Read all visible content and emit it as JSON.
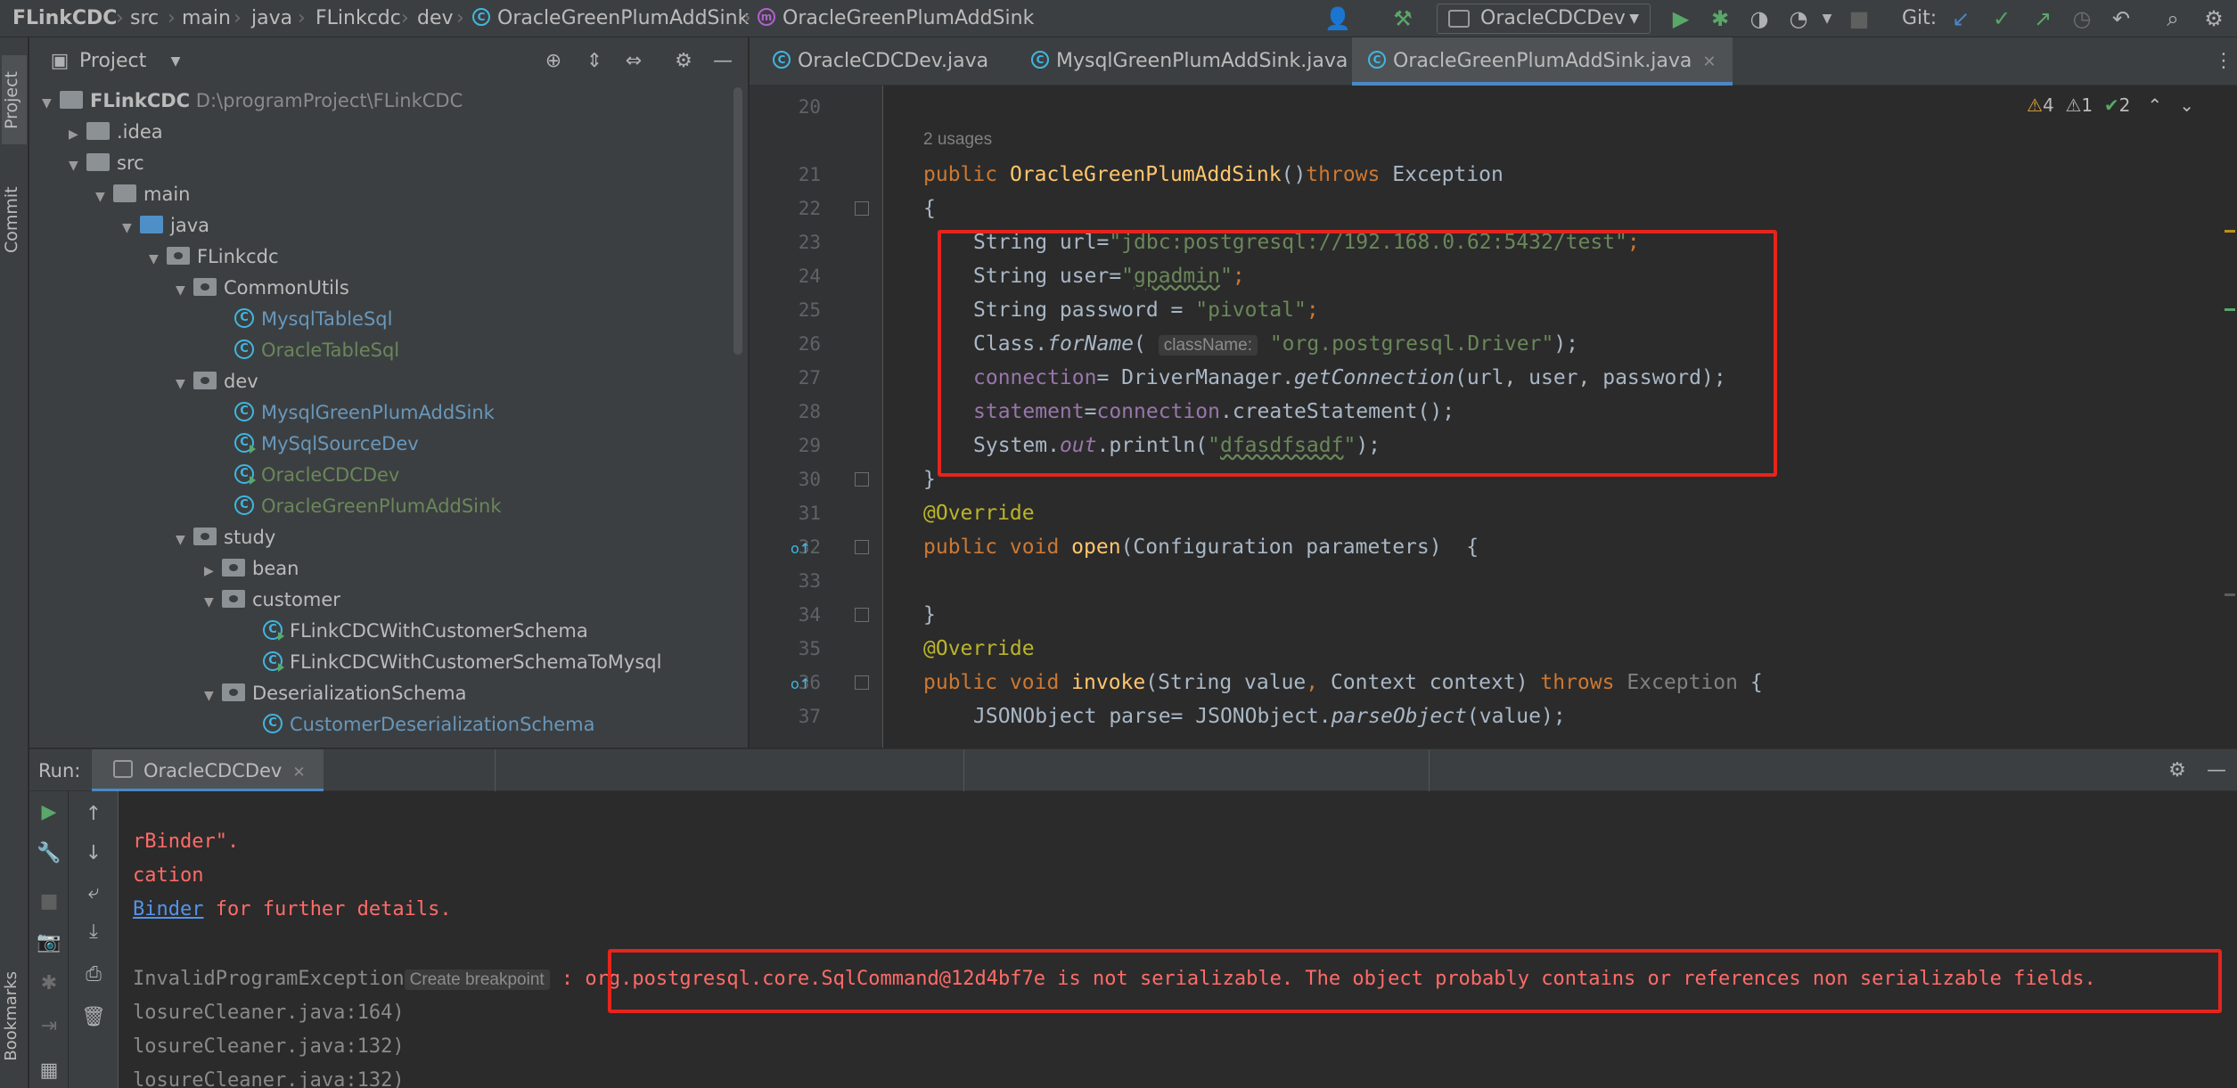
{
  "breadcrumb": {
    "items": [
      "FLinkCDC",
      "src",
      "main",
      "java",
      "FLinkcdc",
      "dev",
      "OracleGreenPlumAddSink",
      "OracleGreenPlumAddSink"
    ]
  },
  "toolbar": {
    "run_config": "OracleCDCDev",
    "git_label": "Git:"
  },
  "left_stripe": {
    "project": "Project",
    "commit": "Commit",
    "bookmarks": "Bookmarks"
  },
  "project_panel": {
    "title": "Project",
    "root_name": "FLinkCDC",
    "root_path": "D:\\programProject\\FLinkCDC",
    "tree": [
      "FLinkCDC",
      ".idea",
      "src",
      "main",
      "java",
      "FLinkcdc",
      "CommonUtils",
      "MysqlTableSql",
      "OracleTableSql",
      "dev",
      "MysqlGreenPlumAddSink",
      "MySqlSourceDev",
      "OracleCDCDev",
      "OracleGreenPlumAddSink",
      "study",
      "bean",
      "customer",
      "FLinkCDCWithCustomerSchema",
      "FLinkCDCWithCustomerSchemaToMysql",
      "DeserializationSchema",
      "CustomerDeserializationSchema"
    ]
  },
  "editor": {
    "tabs": [
      "OracleCDCDev.java",
      "MysqlGreenPlumAddSink.java",
      "OracleGreenPlumAddSink.java"
    ],
    "active_tab": "OracleGreenPlumAddSink.java",
    "inspections": {
      "warnings": "4",
      "weak_warnings": "1",
      "typos": "2"
    },
    "usages": "2 usages",
    "line_numbers": [
      "20",
      "21",
      "22",
      "23",
      "24",
      "25",
      "26",
      "27",
      "28",
      "29",
      "30",
      "31",
      "32",
      "33",
      "34",
      "35",
      "36",
      "37"
    ],
    "code": {
      "l21_kw": "public",
      "l21_name": "OracleGreenPlumAddSink",
      "l21_parens": "()",
      "l21_throws": "throws",
      "l21_exc": " Exception",
      "l22": "{",
      "l23_a": "String url=",
      "l23_str": "\"jdbc:postgresql://192.168.0.62:5432/test\"",
      "l23_end": ";",
      "l24_a": "String user=",
      "l24_q1": "\"",
      "l24_str": "gpadmin",
      "l24_q2": "\"",
      "l24_end": ";",
      "l25_a": "String password = ",
      "l25_str": "\"pivotal\"",
      "l25_end": ";",
      "l26_a": "Class.",
      "l26_fn": "forName",
      "l26_p": "( ",
      "l26_hint": "className:",
      "l26_str": " \"org.postgresql.Driver\"",
      "l26_end": ");",
      "l27_fld": "connection",
      "l27_a": "= DriverManager.",
      "l27_fn": "getConnection",
      "l27_b": "(url, user, password);",
      "l28_fld": "statement",
      "l28_a": "=",
      "l28_fld2": "connection",
      "l28_b": ".createStatement();",
      "l29_a": "System.",
      "l29_out": "out",
      "l29_b": ".println(",
      "l29_q1": "\"",
      "l29_str": "dfasdfsadf",
      "l29_q2": "\"",
      "l29_end": ");",
      "l30": "}",
      "l31": "@Override",
      "l32_kw": "public void ",
      "l32_fn": "open",
      "l32_b": "(Configuration parameters)  {",
      "l34": "}",
      "l35": "@Override",
      "l36_kw": "public void ",
      "l36_fn": "invoke",
      "l36_b": "(String value",
      "l36_c": ",",
      "l36_d": " Context context) ",
      "l36_throws": "throws",
      "l36_exc": " Exception",
      "l36_e": " {",
      "l37_a": "JSONObject parse= JSONObject.",
      "l37_fn": "parseObject",
      "l37_b": "(value);"
    }
  },
  "run_panel": {
    "label": "Run:",
    "tab": "OracleCDCDev",
    "console": {
      "line1": "rBinder\".",
      "line2": "cation",
      "line3_link": "Binder",
      "line3_rest": " for further details.",
      "line4_a": "InvalidProgramException",
      "line4_hint": "Create breakpoint",
      "line4_b": " : org.postgresql.core.SqlCommand@12d4bf7e is not serializable. The object probably contains or references non serializable fields.",
      "line5": "losureCleaner.java:164)",
      "line6": "losureCleaner.java:132)",
      "line7": "losureCleaner.java:132)"
    }
  },
  "colors": {
    "highlight_box": "#e6241c",
    "keyword": "#cc7832",
    "string": "#6a8759",
    "function": "#ffc66d",
    "field": "#9876aa",
    "error_text": "#ff6b68"
  }
}
